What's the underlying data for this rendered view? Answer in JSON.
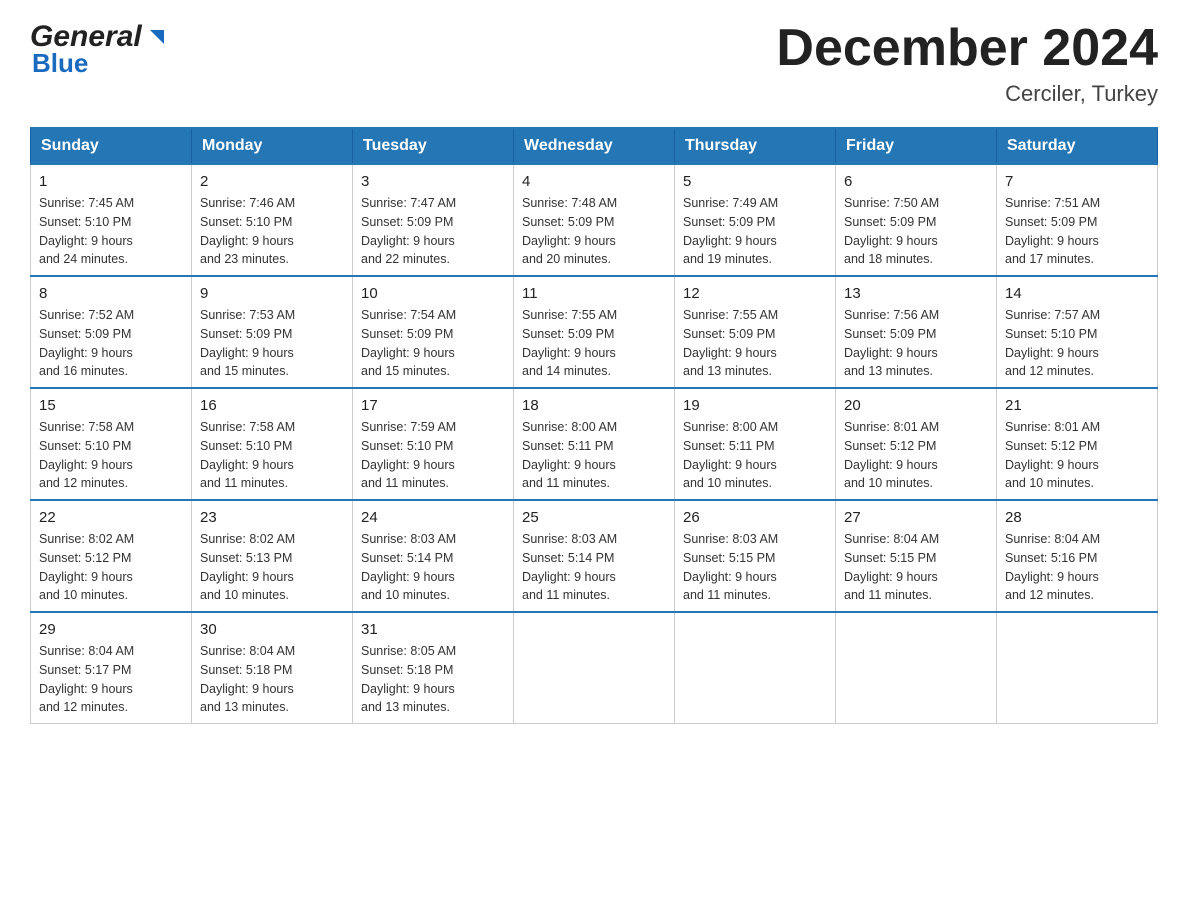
{
  "header": {
    "logo_general": "General",
    "logo_blue": "Blue",
    "title": "December 2024",
    "subtitle": "Cerciler, Turkey"
  },
  "days_of_week": [
    "Sunday",
    "Monday",
    "Tuesday",
    "Wednesday",
    "Thursday",
    "Friday",
    "Saturday"
  ],
  "weeks": [
    [
      {
        "day": "1",
        "sunrise": "7:45 AM",
        "sunset": "5:10 PM",
        "daylight": "9 hours and 24 minutes."
      },
      {
        "day": "2",
        "sunrise": "7:46 AM",
        "sunset": "5:10 PM",
        "daylight": "9 hours and 23 minutes."
      },
      {
        "day": "3",
        "sunrise": "7:47 AM",
        "sunset": "5:09 PM",
        "daylight": "9 hours and 22 minutes."
      },
      {
        "day": "4",
        "sunrise": "7:48 AM",
        "sunset": "5:09 PM",
        "daylight": "9 hours and 20 minutes."
      },
      {
        "day": "5",
        "sunrise": "7:49 AM",
        "sunset": "5:09 PM",
        "daylight": "9 hours and 19 minutes."
      },
      {
        "day": "6",
        "sunrise": "7:50 AM",
        "sunset": "5:09 PM",
        "daylight": "9 hours and 18 minutes."
      },
      {
        "day": "7",
        "sunrise": "7:51 AM",
        "sunset": "5:09 PM",
        "daylight": "9 hours and 17 minutes."
      }
    ],
    [
      {
        "day": "8",
        "sunrise": "7:52 AM",
        "sunset": "5:09 PM",
        "daylight": "9 hours and 16 minutes."
      },
      {
        "day": "9",
        "sunrise": "7:53 AM",
        "sunset": "5:09 PM",
        "daylight": "9 hours and 15 minutes."
      },
      {
        "day": "10",
        "sunrise": "7:54 AM",
        "sunset": "5:09 PM",
        "daylight": "9 hours and 15 minutes."
      },
      {
        "day": "11",
        "sunrise": "7:55 AM",
        "sunset": "5:09 PM",
        "daylight": "9 hours and 14 minutes."
      },
      {
        "day": "12",
        "sunrise": "7:55 AM",
        "sunset": "5:09 PM",
        "daylight": "9 hours and 13 minutes."
      },
      {
        "day": "13",
        "sunrise": "7:56 AM",
        "sunset": "5:09 PM",
        "daylight": "9 hours and 13 minutes."
      },
      {
        "day": "14",
        "sunrise": "7:57 AM",
        "sunset": "5:10 PM",
        "daylight": "9 hours and 12 minutes."
      }
    ],
    [
      {
        "day": "15",
        "sunrise": "7:58 AM",
        "sunset": "5:10 PM",
        "daylight": "9 hours and 12 minutes."
      },
      {
        "day": "16",
        "sunrise": "7:58 AM",
        "sunset": "5:10 PM",
        "daylight": "9 hours and 11 minutes."
      },
      {
        "day": "17",
        "sunrise": "7:59 AM",
        "sunset": "5:10 PM",
        "daylight": "9 hours and 11 minutes."
      },
      {
        "day": "18",
        "sunrise": "8:00 AM",
        "sunset": "5:11 PM",
        "daylight": "9 hours and 11 minutes."
      },
      {
        "day": "19",
        "sunrise": "8:00 AM",
        "sunset": "5:11 PM",
        "daylight": "9 hours and 10 minutes."
      },
      {
        "day": "20",
        "sunrise": "8:01 AM",
        "sunset": "5:12 PM",
        "daylight": "9 hours and 10 minutes."
      },
      {
        "day": "21",
        "sunrise": "8:01 AM",
        "sunset": "5:12 PM",
        "daylight": "9 hours and 10 minutes."
      }
    ],
    [
      {
        "day": "22",
        "sunrise": "8:02 AM",
        "sunset": "5:12 PM",
        "daylight": "9 hours and 10 minutes."
      },
      {
        "day": "23",
        "sunrise": "8:02 AM",
        "sunset": "5:13 PM",
        "daylight": "9 hours and 10 minutes."
      },
      {
        "day": "24",
        "sunrise": "8:03 AM",
        "sunset": "5:14 PM",
        "daylight": "9 hours and 10 minutes."
      },
      {
        "day": "25",
        "sunrise": "8:03 AM",
        "sunset": "5:14 PM",
        "daylight": "9 hours and 11 minutes."
      },
      {
        "day": "26",
        "sunrise": "8:03 AM",
        "sunset": "5:15 PM",
        "daylight": "9 hours and 11 minutes."
      },
      {
        "day": "27",
        "sunrise": "8:04 AM",
        "sunset": "5:15 PM",
        "daylight": "9 hours and 11 minutes."
      },
      {
        "day": "28",
        "sunrise": "8:04 AM",
        "sunset": "5:16 PM",
        "daylight": "9 hours and 12 minutes."
      }
    ],
    [
      {
        "day": "29",
        "sunrise": "8:04 AM",
        "sunset": "5:17 PM",
        "daylight": "9 hours and 12 minutes."
      },
      {
        "day": "30",
        "sunrise": "8:04 AM",
        "sunset": "5:18 PM",
        "daylight": "9 hours and 13 minutes."
      },
      {
        "day": "31",
        "sunrise": "8:05 AM",
        "sunset": "5:18 PM",
        "daylight": "9 hours and 13 minutes."
      },
      null,
      null,
      null,
      null
    ]
  ],
  "labels": {
    "sunrise": "Sunrise:",
    "sunset": "Sunset:",
    "daylight": "Daylight:"
  }
}
